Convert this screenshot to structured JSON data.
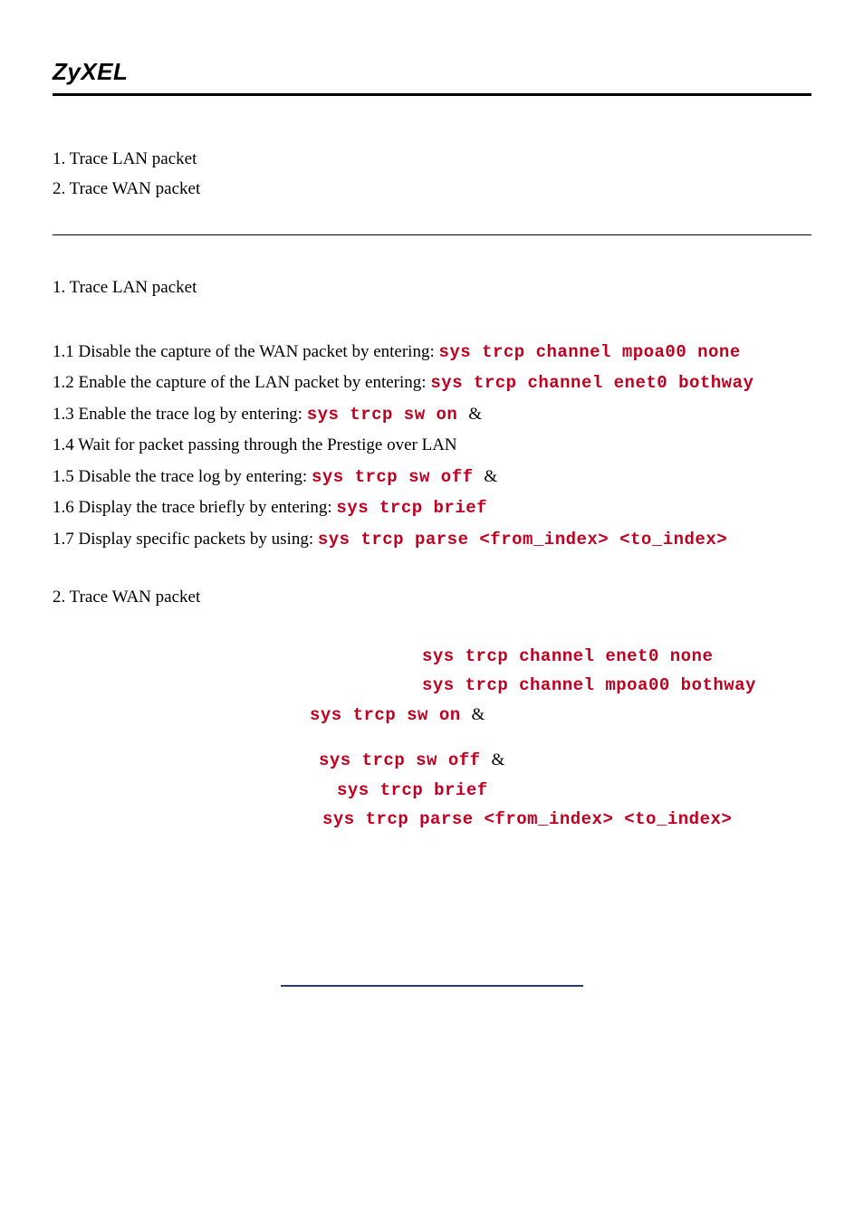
{
  "brand": "ZyXEL",
  "toc": {
    "item1": "1. Trace LAN packet",
    "item2": "2. Trace WAN packet"
  },
  "section1": {
    "title": "1. Trace LAN packet",
    "steps": {
      "s11_pre": "1.1 Disable the capture of the WAN packet by entering: ",
      "s11_cmd": "sys trcp channel mpoa00 none",
      "s12_pre": "1.2 Enable the capture of the LAN packet by entering: ",
      "s12_cmd": "sys trcp channel enet0 bothway",
      "s13_pre": "1.3 Enable the trace log by entering: ",
      "s13_cmd": "sys trcp sw on ",
      "s13_amp": "&",
      "s14": "1.4 Wait for packet passing through the Prestige over LAN",
      "s15_pre": "1.5 Disable the trace log by entering: ",
      "s15_cmd": "sys trcp sw off ",
      "s15_amp": "&",
      "s16_pre": "1.6 Display the trace briefly by entering: ",
      "s16_cmd": "sys trcp brief",
      "s17_pre": "1.7 Display specific packets by using: ",
      "s17_cmd": "sys trcp parse <from_index> <to_index>"
    }
  },
  "section2": {
    "title": "2. Trace WAN packet",
    "lines": {
      "l1": "sys trcp channel enet0 none",
      "l2": "sys trcp channel mpoa00 bothway",
      "l3_cmd": "sys trcp sw on ",
      "l3_amp": "&",
      "l4_cmd": "sys trcp sw off ",
      "l4_amp": "&",
      "l5": "sys trcp brief",
      "l6": "sys trcp parse <from_index> <to_index>"
    }
  }
}
